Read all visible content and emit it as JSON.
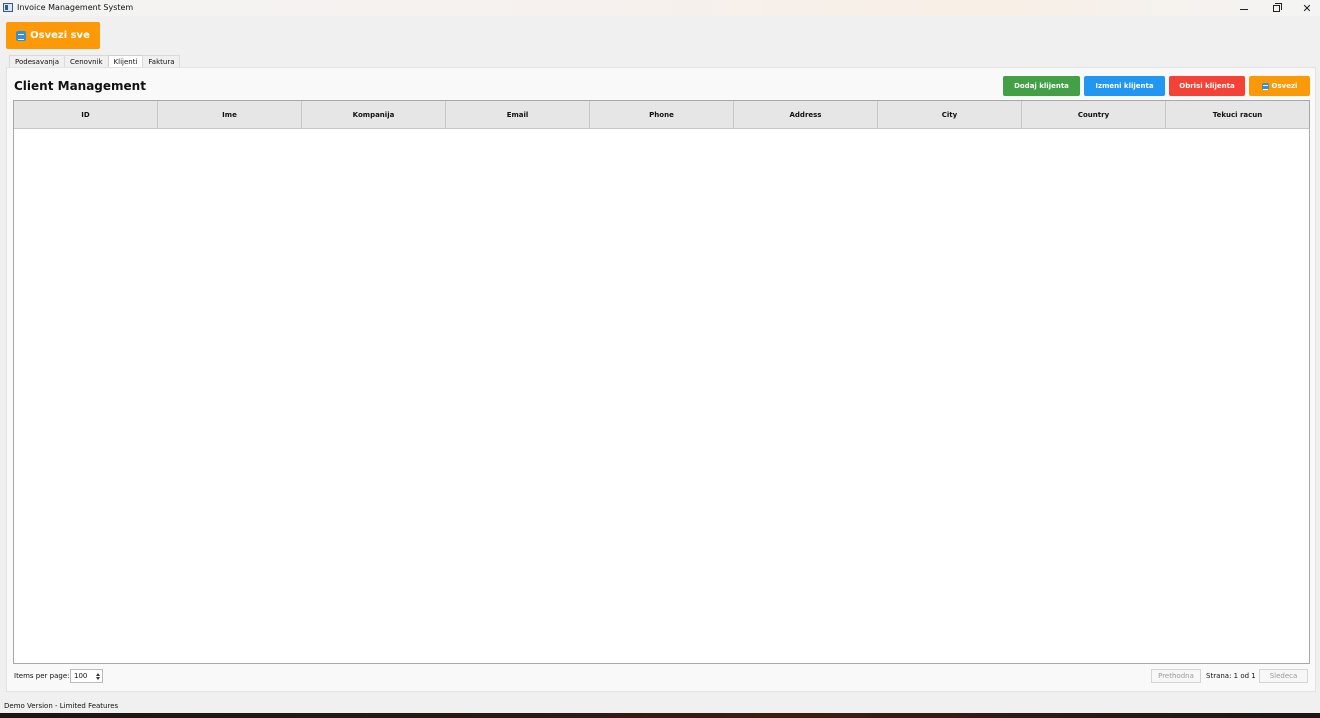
{
  "window": {
    "title": "Invoice Management System",
    "controls": [
      "minimize",
      "maximize",
      "close"
    ]
  },
  "toolbar": {
    "refresh_all_label": "Osvezi sve",
    "refresh_all_icon": "refresh-icon",
    "refresh_all_color": "#fb9a06"
  },
  "tabs": [
    {
      "label": "Podesavanja",
      "active": false
    },
    {
      "label": "Cenovnik",
      "active": false
    },
    {
      "label": "Klijenti",
      "active": true
    },
    {
      "label": "Faktura",
      "active": false
    }
  ],
  "main": {
    "title": "Client Management",
    "actions": {
      "add_label": "Dodaj klijenta",
      "add_color": "#43a047",
      "edit_label": "Izmeni klijenta",
      "edit_color": "#2196f3",
      "delete_label": "Obrisi klijenta",
      "delete_color": "#f44336",
      "refresh_label": "Osvezi",
      "refresh_color": "#fb9a06"
    },
    "table": {
      "columns": [
        "ID",
        "Ime",
        "Kompanija",
        "Email",
        "Phone",
        "Address",
        "City",
        "Country",
        "Tekuci racun"
      ],
      "rows": []
    }
  },
  "pagination": {
    "items_per_page_label": "Items per page:",
    "items_per_page_value": "100",
    "prev_label": "Prethodna",
    "page_text": "Strana: 1 od 1",
    "next_label": "Sledeca"
  },
  "status_bar": {
    "text": "Demo Version - Limited Features"
  }
}
